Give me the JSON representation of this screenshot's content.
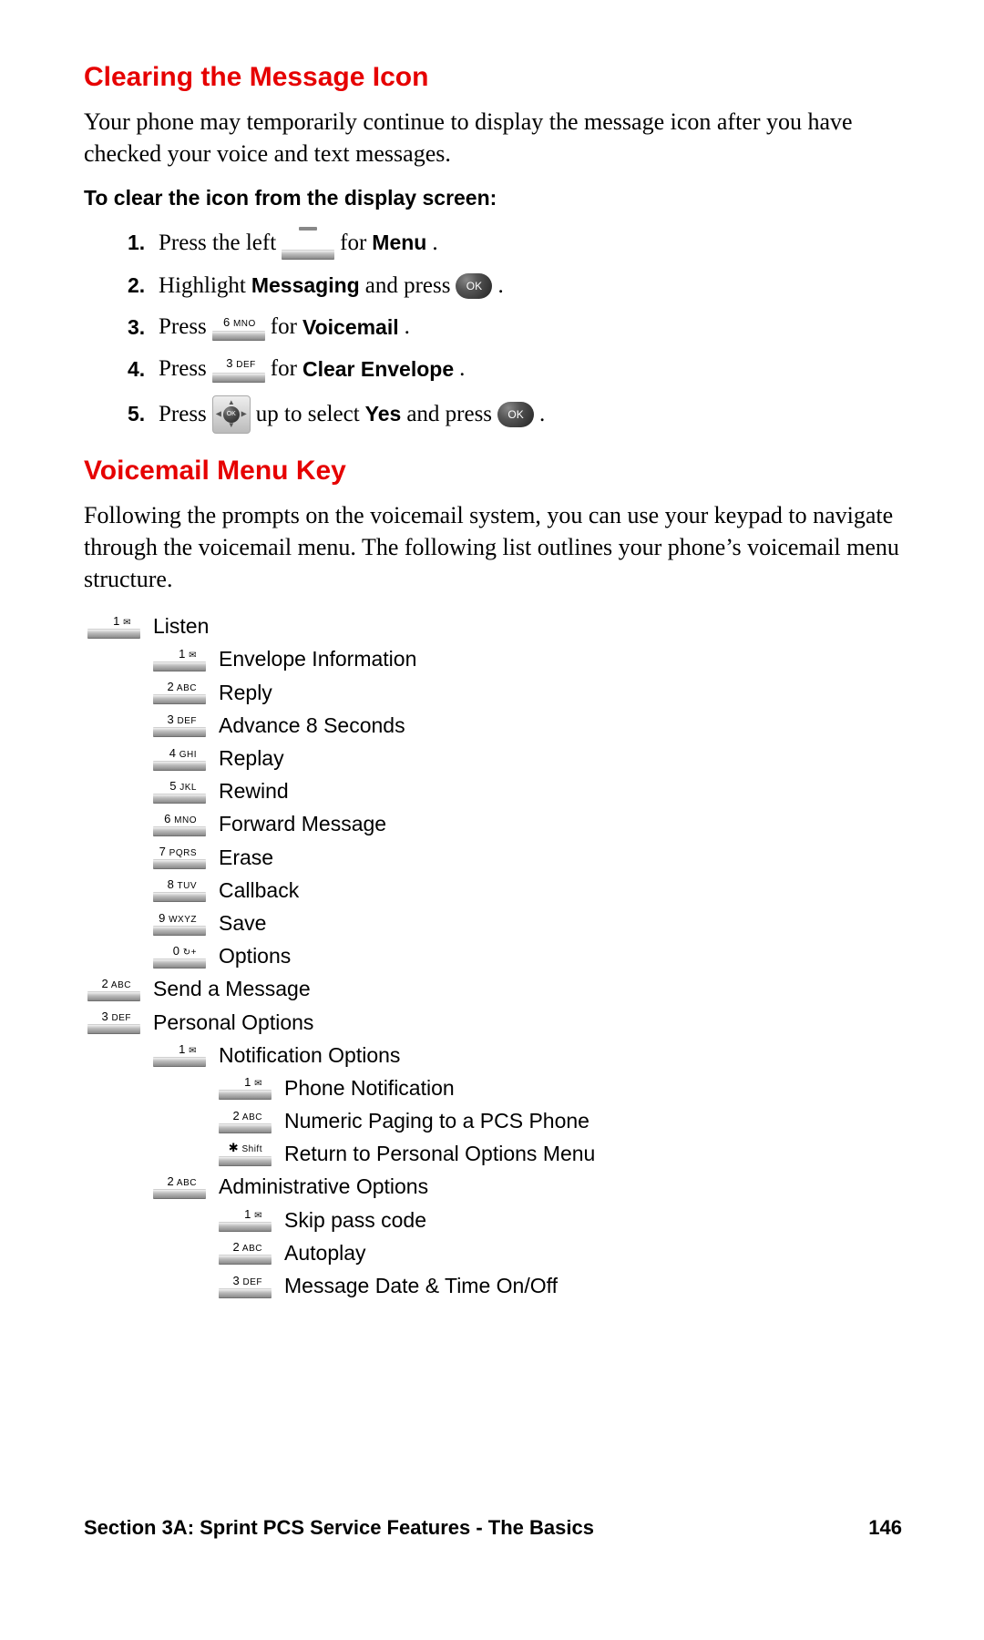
{
  "heading1": "Clearing the Message Icon",
  "intro1": "Your phone may temporarily continue to display the message icon after you have checked your voice and text messages.",
  "sub_bold": "To clear the icon from the display screen:",
  "steps": [
    {
      "num": "1.",
      "a": "Press the left ",
      "key_label": "",
      "b": " for ",
      "bold": "Menu",
      "c": "."
    },
    {
      "num": "2.",
      "a": "Highlight ",
      "bold": "Messaging",
      "b": " and press ",
      "ok": "OK",
      "c": " ."
    },
    {
      "num": "3.",
      "a": "Press ",
      "key_label": "6 MNO",
      "b": " for ",
      "bold": "Voicemail",
      "c": "."
    },
    {
      "num": "4.",
      "a": "Press ",
      "key_label": "3 DEF",
      "b": " for ",
      "bold": "Clear Envelope",
      "c": "."
    },
    {
      "num": "5.",
      "a": "Press ",
      "nav": true,
      "b": " up to select ",
      "bold": "Yes",
      "c": " and press ",
      "ok": "OK",
      "d": " ."
    }
  ],
  "heading2": "Voicemail Menu Key",
  "intro2": "Following the prompts on the voicemail system, you can use your keypad to navigate through the voicemail menu. The following list outlines your phone’s voicemail menu structure.",
  "keys": {
    "1": {
      "big": "1",
      "small": "✉"
    },
    "2": {
      "big": "2",
      "small": "ABC"
    },
    "3": {
      "big": "3",
      "small": "DEF"
    },
    "4": {
      "big": "4",
      "small": "GHI"
    },
    "5": {
      "big": "5",
      "small": "JKL"
    },
    "6": {
      "big": "6",
      "small": "MNO"
    },
    "7": {
      "big": "7",
      "small": "PQRS"
    },
    "8": {
      "big": "8",
      "small": "TUV"
    },
    "9": {
      "big": "9",
      "small": "WXYZ"
    },
    "0": {
      "big": "0",
      "small": "↻+"
    },
    "star": {
      "big": "✱",
      "small": "Shift"
    }
  },
  "tree": [
    {
      "key": "1",
      "label": "Listen",
      "children": [
        {
          "key": "1",
          "label": "Envelope Information"
        },
        {
          "key": "2",
          "label": "Reply"
        },
        {
          "key": "3",
          "label": "Advance 8 Seconds"
        },
        {
          "key": "4",
          "label": "Replay"
        },
        {
          "key": "5",
          "label": "Rewind"
        },
        {
          "key": "6",
          "label": "Forward Message"
        },
        {
          "key": "7",
          "label": "Erase"
        },
        {
          "key": "8",
          "label": "Callback"
        },
        {
          "key": "9",
          "label": "Save"
        },
        {
          "key": "0",
          "label": "Options"
        }
      ]
    },
    {
      "key": "2",
      "label": "Send a Message"
    },
    {
      "key": "3",
      "label": "Personal Options",
      "children": [
        {
          "key": "1",
          "label": "Notification Options",
          "children": [
            {
              "key": "1",
              "label": "Phone Notification"
            },
            {
              "key": "2",
              "label": "Numeric Paging to a PCS Phone"
            },
            {
              "key": "star",
              "label": "Return to Personal Options Menu"
            }
          ]
        },
        {
          "key": "2",
          "label": "Administrative Options",
          "children": [
            {
              "key": "1",
              "label": "Skip pass code"
            },
            {
              "key": "2",
              "label": "Autoplay"
            },
            {
              "key": "3",
              "label": "Message Date & Time On/Off"
            }
          ]
        }
      ]
    }
  ],
  "footer_left": "Section 3A: Sprint PCS Service Features - The Basics",
  "footer_right": "146"
}
